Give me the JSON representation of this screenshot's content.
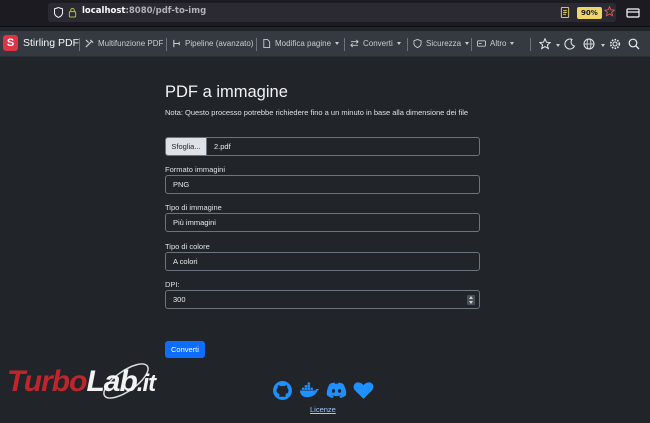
{
  "browser": {
    "url_host": "localhost",
    "url_path": ":8080/pdf-to-img",
    "zoom": "90%",
    "icons": [
      "shield-icon",
      "lock-icon",
      "reader-icon",
      "bookmark-star-icon",
      "extension-icon"
    ]
  },
  "nav": {
    "brand": "Stirling PDF",
    "brand_logo_letter": "S",
    "items": [
      {
        "label": "Multifunzione PDF",
        "icon": "tools-icon"
      },
      {
        "label": "Pipeline (avanzato)",
        "icon": "pipeline-icon"
      },
      {
        "label": "Modifica pagine",
        "icon": "file-edit-icon",
        "dropdown": true
      },
      {
        "label": "Converti",
        "icon": "arrows-icon",
        "dropdown": true
      },
      {
        "label": "Sicurezza",
        "icon": "shield-icon",
        "dropdown": true
      },
      {
        "label": "Altro",
        "icon": "card-icon",
        "dropdown": true
      }
    ],
    "right_icons": [
      "star-icon",
      "moon-icon",
      "globe-icon",
      "gear-icon",
      "search-icon"
    ]
  },
  "form": {
    "title": "PDF a immagine",
    "note": "Nota: Questo processo potrebbe richiedere fino a un minuto in base alla dimensione dei file",
    "file_button": "Sfoglia...",
    "file_name": "2.pdf",
    "format_label": "Formato immagini",
    "format_value": "PNG",
    "type_label": "Tipo di immagine",
    "type_value": "Più immagini",
    "color_label": "Tipo di colore",
    "color_value": "A colori",
    "dpi_label": "DPI:",
    "dpi_value": "300",
    "submit": "Converti"
  },
  "footer": {
    "icons": [
      "github-icon",
      "docker-icon",
      "discord-icon",
      "heart-icon"
    ],
    "license_link": "Licenze"
  },
  "watermark": {
    "part1": "Turbo",
    "part2": "Lab",
    "part3": ".it"
  },
  "colors": {
    "accent": "#0d6efd",
    "brand_red": "#dc3545",
    "zoom_badge": "#f0d669",
    "footer_icon": "#1e90ff"
  }
}
